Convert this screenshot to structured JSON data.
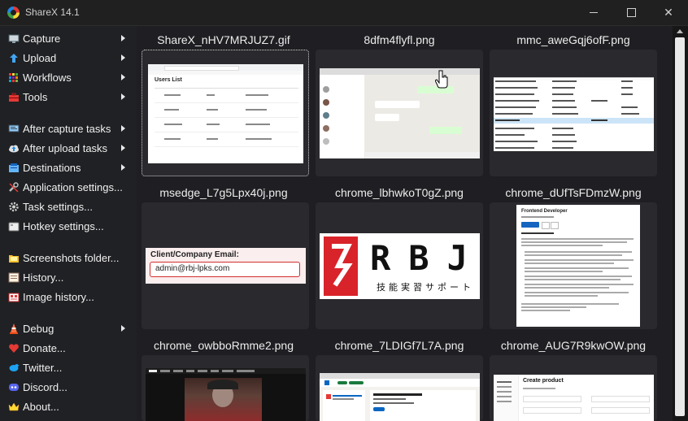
{
  "window": {
    "title": "ShareX 14.1"
  },
  "menu": [
    {
      "label": "Capture",
      "icon": "monitor-capture-icon",
      "submenu": true
    },
    {
      "label": "Upload",
      "icon": "upload-arrow-icon",
      "submenu": true
    },
    {
      "label": "Workflows",
      "icon": "workflows-grid-icon",
      "submenu": true
    },
    {
      "label": "Tools",
      "icon": "toolbox-icon",
      "submenu": true
    },
    {
      "label": "After capture tasks",
      "icon": "after-capture-icon",
      "submenu": true
    },
    {
      "label": "After upload tasks",
      "icon": "cloud-upload-icon",
      "submenu": true
    },
    {
      "label": "Destinations",
      "icon": "destinations-icon",
      "submenu": true
    },
    {
      "label": "Application settings...",
      "icon": "wrench-icon",
      "submenu": false
    },
    {
      "label": "Task settings...",
      "icon": "gear-icon",
      "submenu": false
    },
    {
      "label": "Hotkey settings...",
      "icon": "keyboard-icon",
      "submenu": false
    },
    {
      "label": "Screenshots folder...",
      "icon": "folder-icon",
      "submenu": false
    },
    {
      "label": "History...",
      "icon": "history-icon",
      "submenu": false
    },
    {
      "label": "Image history...",
      "icon": "image-history-icon",
      "submenu": false
    },
    {
      "label": "Debug",
      "icon": "traffic-cone-icon",
      "submenu": true
    },
    {
      "label": "Donate...",
      "icon": "heart-icon",
      "submenu": false
    },
    {
      "label": "Twitter...",
      "icon": "twitter-bird-icon",
      "submenu": false
    },
    {
      "label": "Discord...",
      "icon": "discord-icon",
      "submenu": false
    },
    {
      "label": "About...",
      "icon": "crown-icon",
      "submenu": false
    }
  ],
  "files": [
    {
      "name": "ShareX_nHV7MRJUZ7.gif",
      "selected": true
    },
    {
      "name": "8dfm4flyfl.png",
      "selected": false
    },
    {
      "name": "mmc_aweGqj6ofF.png",
      "selected": false
    },
    {
      "name": "msedge_L7g5Lpx40j.png",
      "selected": false
    },
    {
      "name": "chrome_lbhwkoT0gZ.png",
      "selected": false
    },
    {
      "name": "chrome_dUfTsFDmzW.png",
      "selected": false
    },
    {
      "name": "chrome_owbboRmme2.png",
      "selected": false
    },
    {
      "name": "chrome_7LDIGf7L7A.png",
      "selected": false
    },
    {
      "name": "chrome_AUG7R9kwOW.png",
      "selected": false
    }
  ],
  "thumb_content": {
    "users_list_title": "Users List",
    "email_label": "Client/Company Email:",
    "email_value": "admin@rbj-lpks.com",
    "rbj_logo_text": "RBJ",
    "rbj_tagline": "技能実習サポート",
    "job_title": "Frontend Developer",
    "product_title": "Create product"
  },
  "colors": {
    "background": "#1f1f23",
    "sidebar": "#202124",
    "thumb_bg": "#2a2a2e",
    "rbj_red": "#d9232a"
  }
}
